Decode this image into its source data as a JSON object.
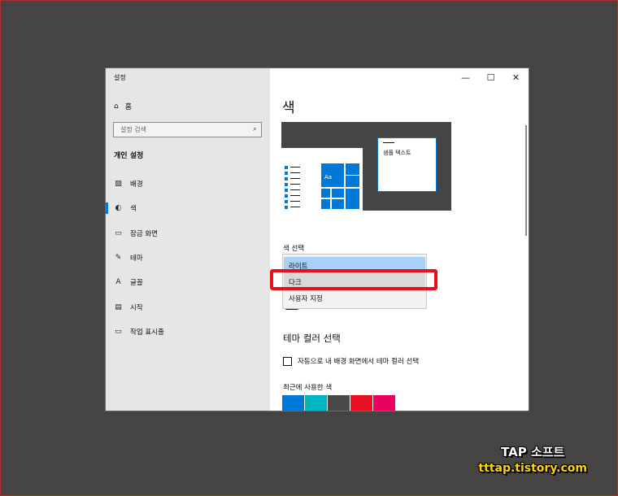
{
  "window": {
    "title": "설정",
    "minimize": "—",
    "maximize": "☐",
    "close": "✕"
  },
  "sidebar": {
    "home_label": "홈",
    "search_placeholder": "설정 검색",
    "section_title": "개인 설정",
    "items": [
      {
        "label": "배경",
        "icon": "image-icon",
        "glyph": "▨"
      },
      {
        "label": "색",
        "icon": "palette-icon",
        "glyph": "◐",
        "active": true
      },
      {
        "label": "잠금 화면",
        "icon": "lock-screen-icon",
        "glyph": "▭"
      },
      {
        "label": "테마",
        "icon": "theme-icon",
        "glyph": "✎"
      },
      {
        "label": "글꼴",
        "icon": "font-icon",
        "glyph": "A"
      },
      {
        "label": "시작",
        "icon": "start-icon",
        "glyph": "▤"
      },
      {
        "label": "작업 표시줄",
        "icon": "taskbar-icon",
        "glyph": "▭"
      }
    ]
  },
  "main": {
    "page_title": "색",
    "preview_sample_text": "샘플 텍스트",
    "preview_tile_text": "Aa",
    "color_select_label": "색 선택",
    "dropdown_options": [
      {
        "label": "라이트",
        "state": "selected"
      },
      {
        "label": "다크",
        "state": "hover"
      },
      {
        "label": "사용자 지정",
        "state": "normal"
      }
    ],
    "theme_color_heading": "테마 컬러 선택",
    "auto_color_checkbox_label": "자동으로 내 배경 화면에서 테마 컬러 선택",
    "recent_colors_label": "최근에 사용한 색",
    "recent_colors": [
      "#0078d7",
      "#00b4c4",
      "#4a4a4a",
      "#e81123",
      "#ea005e"
    ]
  },
  "accent_color": "#0078d7",
  "highlight_color": "#e8101c",
  "watermark": {
    "title": "TAP 소프트",
    "url": "tttap.tistory.com"
  }
}
